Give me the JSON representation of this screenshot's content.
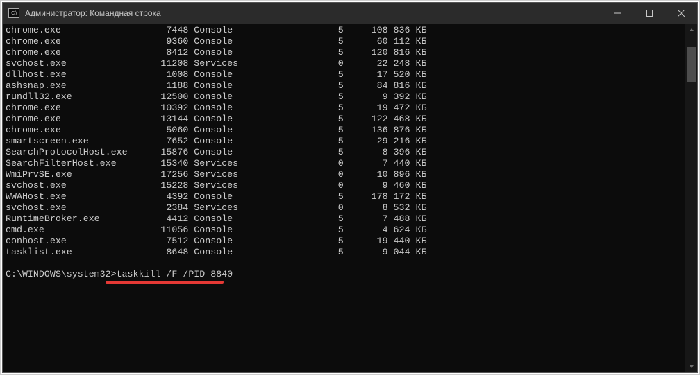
{
  "window": {
    "title": "Администратор: Командная строка",
    "icon_label": "C:\\"
  },
  "columns": {
    "mem_unit": "КБ"
  },
  "tasks": [
    {
      "name": "chrome.exe",
      "pid": 7448,
      "session": "Console",
      "sess_no": 5,
      "mem": "108 836"
    },
    {
      "name": "chrome.exe",
      "pid": 9360,
      "session": "Console",
      "sess_no": 5,
      "mem": "60 112"
    },
    {
      "name": "chrome.exe",
      "pid": 8412,
      "session": "Console",
      "sess_no": 5,
      "mem": "120 816"
    },
    {
      "name": "svchost.exe",
      "pid": 11208,
      "session": "Services",
      "sess_no": 0,
      "mem": "22 248"
    },
    {
      "name": "dllhost.exe",
      "pid": 1008,
      "session": "Console",
      "sess_no": 5,
      "mem": "17 520"
    },
    {
      "name": "ashsnap.exe",
      "pid": 1188,
      "session": "Console",
      "sess_no": 5,
      "mem": "84 816"
    },
    {
      "name": "rundll32.exe",
      "pid": 12500,
      "session": "Console",
      "sess_no": 5,
      "mem": "9 392"
    },
    {
      "name": "chrome.exe",
      "pid": 10392,
      "session": "Console",
      "sess_no": 5,
      "mem": "19 472"
    },
    {
      "name": "chrome.exe",
      "pid": 13144,
      "session": "Console",
      "sess_no": 5,
      "mem": "122 468"
    },
    {
      "name": "chrome.exe",
      "pid": 5060,
      "session": "Console",
      "sess_no": 5,
      "mem": "136 876"
    },
    {
      "name": "smartscreen.exe",
      "pid": 7652,
      "session": "Console",
      "sess_no": 5,
      "mem": "29 216"
    },
    {
      "name": "SearchProtocolHost.exe",
      "pid": 15876,
      "session": "Console",
      "sess_no": 5,
      "mem": "8 396"
    },
    {
      "name": "SearchFilterHost.exe",
      "pid": 15340,
      "session": "Services",
      "sess_no": 0,
      "mem": "7 440"
    },
    {
      "name": "WmiPrvSE.exe",
      "pid": 17256,
      "session": "Services",
      "sess_no": 0,
      "mem": "10 896"
    },
    {
      "name": "svchost.exe",
      "pid": 15228,
      "session": "Services",
      "sess_no": 0,
      "mem": "9 460"
    },
    {
      "name": "WWAHost.exe",
      "pid": 4392,
      "session": "Console",
      "sess_no": 5,
      "mem": "178 172"
    },
    {
      "name": "svchost.exe",
      "pid": 2384,
      "session": "Services",
      "sess_no": 0,
      "mem": "8 532"
    },
    {
      "name": "RuntimeBroker.exe",
      "pid": 4412,
      "session": "Console",
      "sess_no": 5,
      "mem": "7 488"
    },
    {
      "name": "cmd.exe",
      "pid": 11056,
      "session": "Console",
      "sess_no": 5,
      "mem": "4 624"
    },
    {
      "name": "conhost.exe",
      "pid": 7512,
      "session": "Console",
      "sess_no": 5,
      "mem": "19 440"
    },
    {
      "name": "tasklist.exe",
      "pid": 8648,
      "session": "Console",
      "sess_no": 5,
      "mem": "9 044"
    }
  ],
  "prompt": {
    "path": "C:\\WINDOWS\\system32>",
    "command": "taskkill /F /PID 8840"
  }
}
